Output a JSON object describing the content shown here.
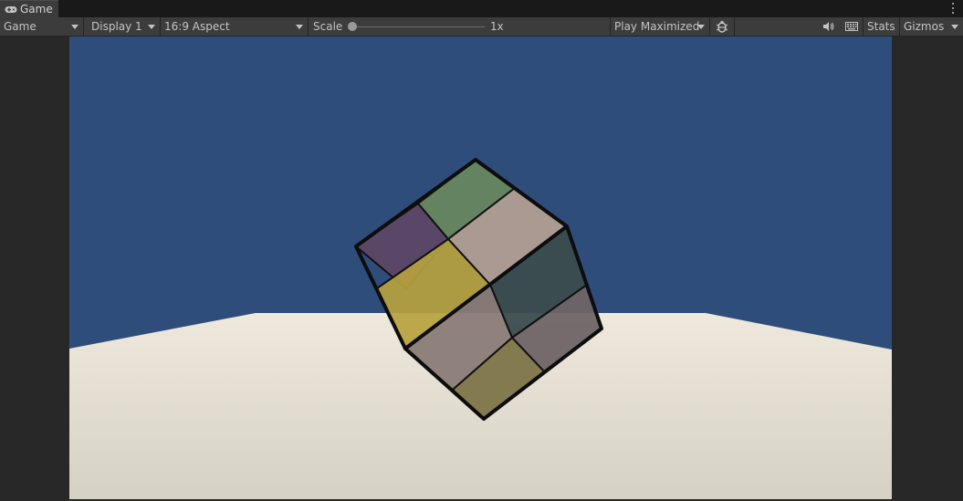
{
  "window": {
    "tab_label": "Game"
  },
  "toolbar": {
    "view_select": "Game",
    "display_select": "Display 1",
    "aspect_select": "16:9 Aspect",
    "scale_label": "Scale",
    "scale_value": "1x",
    "scale_level": 0.0,
    "play_mode_select": "Play Maximized",
    "stats_label": "Stats",
    "gizmos_label": "Gizmos"
  },
  "icons": {
    "tab": "gamepad-icon",
    "menu": "kebab-menu-icon",
    "debug": "bug-icon",
    "audio": "speaker-icon",
    "shortcuts": "keyboard-icon"
  },
  "scene": {
    "sky_color": "#2e4d7b",
    "ground_color": "#e6e0d0",
    "cube_face_colors": {
      "top": [
        "#67865f",
        "#5d4766",
        "#b29e94",
        "#b7a23e"
      ],
      "right": [
        "#3b4c4e",
        "#6f6466",
        "#8a7b76",
        "#7e7449"
      ]
    }
  }
}
